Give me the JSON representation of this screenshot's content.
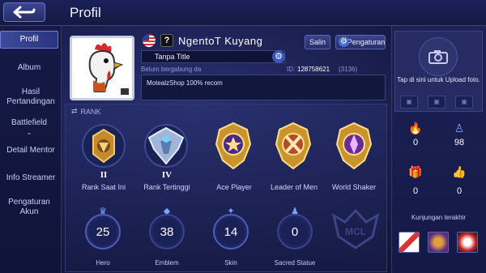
{
  "header": {
    "title": "Profil",
    "back_icon": "back-arrow-icon"
  },
  "sidebar": {
    "items": [
      {
        "label": "Profil",
        "active": true
      },
      {
        "label": "Album"
      },
      {
        "label": "Hasil Pertandingan"
      },
      {
        "label": "Battlefield"
      },
      {
        "label": "Detail Mentor"
      },
      {
        "label": "Info Streamer"
      },
      {
        "label": "Pengaturan Akun"
      }
    ]
  },
  "profile": {
    "name": "NgentoT Kuyang",
    "copy_label": "Salin",
    "settings_label": "Pengaturan",
    "title_value": "Tanpa Title",
    "join_text": "Belum bergabung da",
    "id_label": "ID:",
    "id_value": "128758621",
    "server": "(3136)",
    "bio": "MotealzShop 100% recom"
  },
  "rank": {
    "header": "RANK",
    "badges": [
      {
        "label": "Rank Saat Ini",
        "roman": "II"
      },
      {
        "label": "Rank Tertinggi",
        "roman": "IV"
      },
      {
        "label": "Ace Player"
      },
      {
        "label": "Leader of Men"
      },
      {
        "label": "World Shaker"
      }
    ]
  },
  "stats": [
    {
      "label": "Hero",
      "value": "25",
      "icon": "hero-icon"
    },
    {
      "label": "Emblem",
      "value": "38",
      "icon": "emblem-icon"
    },
    {
      "label": "Skin",
      "value": "14",
      "icon": "skin-icon"
    },
    {
      "label": "Sacred Statue",
      "value": "0",
      "icon": "statue-icon"
    }
  ],
  "right_panel": {
    "upload_text": "Tap di sini untuk Upload foto.",
    "stats": [
      {
        "value": "0",
        "icon": "fire-icon"
      },
      {
        "value": "98",
        "icon": "people-icon"
      },
      {
        "value": "0",
        "icon": "gift-icon"
      },
      {
        "value": "0",
        "icon": "thumbs-up-icon"
      }
    ],
    "recent_visits_label": "Kunjungan terakhir"
  },
  "colors": {
    "accent": "#4f5cb8",
    "background": "#171c48",
    "gold": "#d9a63a"
  }
}
